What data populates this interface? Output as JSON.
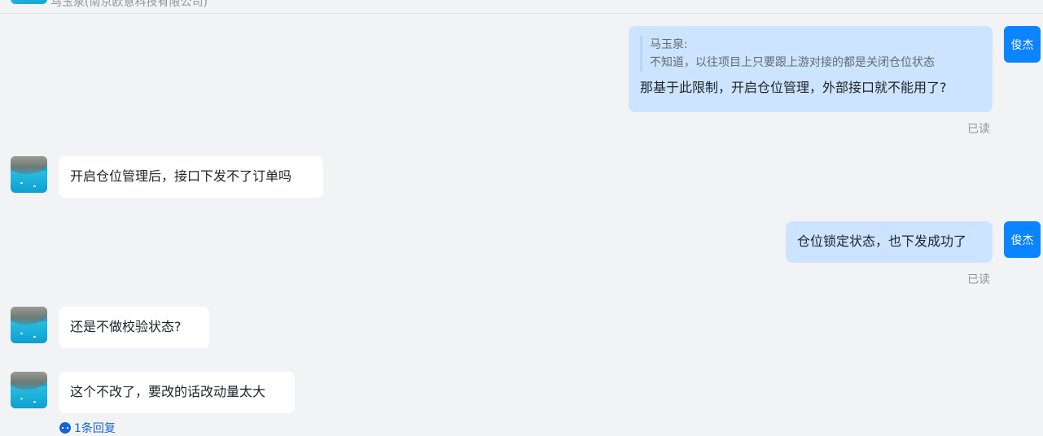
{
  "header": {
    "sender_name": "马玉泉(南京欧意科技有限公司)"
  },
  "messages": [
    {
      "side": "mine",
      "avatar_label": "俊杰",
      "quote_author": "马玉泉:",
      "quote_text": "不知道，以往项目上只要跟上游对接的都是关闭仓位状态",
      "text": "那基于此限制，开启仓位管理，外部接口就不能用了?",
      "status": "已读"
    },
    {
      "side": "theirs",
      "text": "开启仓位管理后，接口下发不了订单吗"
    },
    {
      "side": "mine",
      "avatar_label": "俊杰",
      "text": "仓位锁定状态，也下发成功了",
      "status": "已读"
    },
    {
      "side": "theirs",
      "text": "还是不做校验状态?"
    },
    {
      "side": "theirs",
      "text": "这个不改了，要改的话改动量太大",
      "reply_count_label": "1条回复"
    }
  ],
  "colors": {
    "background": "#f2f3f5",
    "my_bubble": "#cce4ff",
    "their_bubble": "#ffffff",
    "self_avatar": "#0a84ff",
    "link": "#1664d9"
  }
}
